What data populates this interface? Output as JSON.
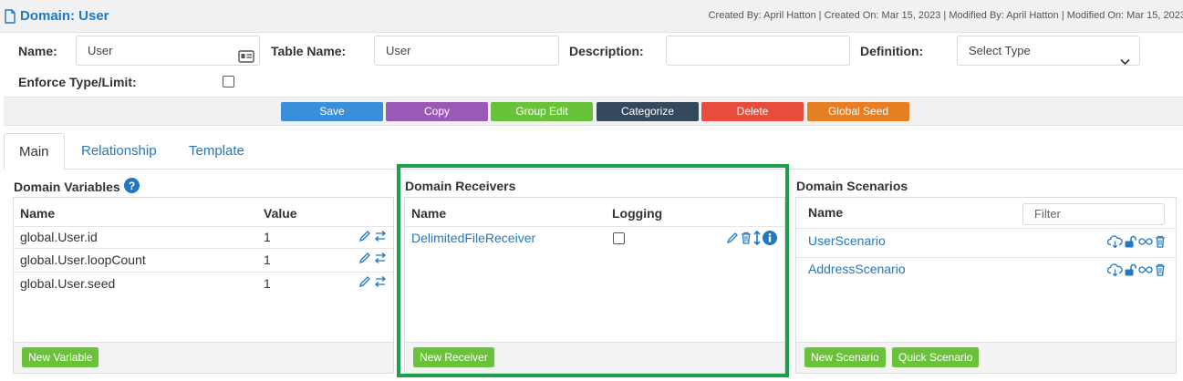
{
  "header": {
    "title": "Domain: User",
    "meta": "Created By: April Hatton | Created On: Mar 15, 2023 | Modified By: April Hatton | Modified On: Mar 15, 2023"
  },
  "form": {
    "name_label": "Name:",
    "name_value": "User",
    "table_name_label": "Table Name:",
    "table_name_value": "User",
    "description_label": "Description:",
    "description_value": "",
    "definition_label": "Definition:",
    "definition_selected": "Select Type",
    "enforce_label": "Enforce Type/Limit:",
    "enforce_checked": false
  },
  "actions": [
    {
      "label": "Save",
      "color": "#3a8fd9"
    },
    {
      "label": "Copy",
      "color": "#9b59b6"
    },
    {
      "label": "Group Edit",
      "color": "#6ac23a"
    },
    {
      "label": "Categorize",
      "color": "#34495e"
    },
    {
      "label": "Delete",
      "color": "#e74c3c"
    },
    {
      "label": "Global Seed",
      "color": "#e67e22"
    }
  ],
  "tabs": [
    {
      "label": "Main",
      "active": true
    },
    {
      "label": "Relationship",
      "active": false
    },
    {
      "label": "Template",
      "active": false
    }
  ],
  "variables": {
    "title": "Domain Variables",
    "col_name": "Name",
    "col_value": "Value",
    "rows": [
      {
        "name": "global.User.id",
        "value": "1"
      },
      {
        "name": "global.User.loopCount",
        "value": "1"
      },
      {
        "name": "global.User.seed",
        "value": "1"
      }
    ],
    "new_button": "New Variable"
  },
  "receivers": {
    "title": "Domain Receivers",
    "col_name": "Name",
    "col_logging": "Logging",
    "rows": [
      {
        "name": "DelimitedFileReceiver",
        "logging": false
      }
    ],
    "new_button": "New Receiver"
  },
  "scenarios": {
    "title": "Domain Scenarios",
    "col_name": "Name",
    "filter_placeholder": "Filter",
    "rows": [
      {
        "name": "UserScenario"
      },
      {
        "name": "AddressScenario"
      }
    ],
    "new_button": "New Scenario",
    "quick_button": "Quick Scenario"
  },
  "colors": {
    "link": "#1f78c1",
    "highlight": "#1aa049",
    "green_button": "#6ac23a"
  }
}
